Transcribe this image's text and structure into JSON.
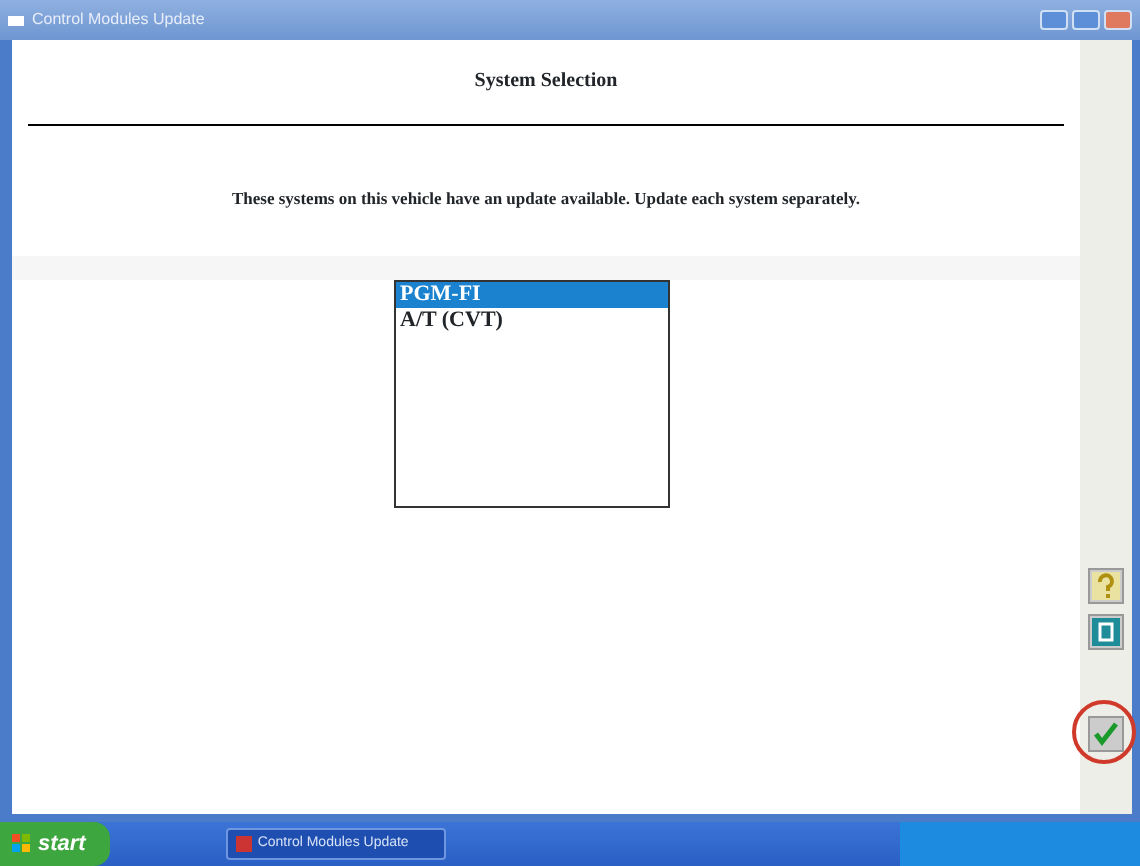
{
  "window": {
    "title": "Control Modules Update"
  },
  "header": {
    "title": "System Selection"
  },
  "message": "These systems on this vehicle have an update available. Update each system separately.",
  "systems": [
    {
      "label": "PGM-FI",
      "selected": true
    },
    {
      "label": "A/T (CVT)",
      "selected": false
    }
  ],
  "side_buttons": [
    {
      "kind": "help",
      "highlighted": false
    },
    {
      "kind": "manual",
      "highlighted": false
    },
    {
      "kind": "ok",
      "highlighted": true
    }
  ],
  "taskbar": {
    "start": "start",
    "tasks": [
      {
        "label": "Control Modules Update",
        "selected": true
      }
    ]
  }
}
